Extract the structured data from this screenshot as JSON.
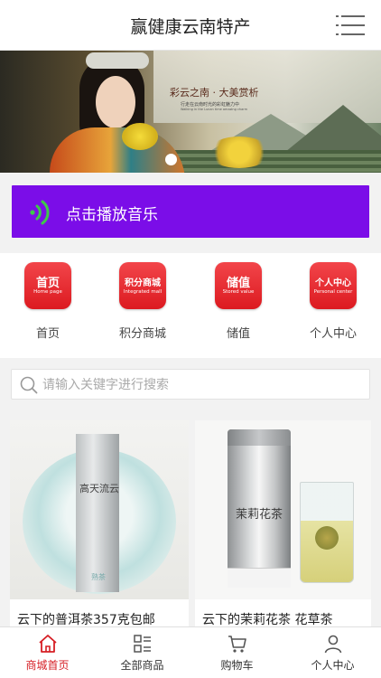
{
  "header": {
    "title": "赢健康云南特产",
    "menu_icon": "menu-list-icon"
  },
  "banner": {
    "caption_main": "彩云之南 · 大美赏析",
    "caption_sub": "行走在云南时光的彩虹魅力中",
    "caption_en": "Walking in the Lunan time amazing charm",
    "active_slide": 1,
    "slide_count": 1
  },
  "music": {
    "label": "点击播放音乐",
    "icon": "sound-wave-icon",
    "color": "#7b0de8"
  },
  "nav": {
    "items": [
      {
        "tile_cn": "首页",
        "tile_en": "Home page",
        "label": "首页"
      },
      {
        "tile_cn": "积分商城",
        "tile_en": "Integrated mall",
        "label": "积分商城"
      },
      {
        "tile_cn": "储值",
        "tile_en": "Stored value",
        "label": "储值"
      },
      {
        "tile_cn": "个人中心",
        "tile_en": "Personal center",
        "label": "个人中心"
      }
    ],
    "tile_color": "#e2262b"
  },
  "search": {
    "placeholder": "请输入关键字进行搜索",
    "value": "",
    "icon": "search-icon"
  },
  "products": [
    {
      "name": "云下的普洱茶357克包邮",
      "package_text": "高天流云",
      "wrapper_text": "熟茶"
    },
    {
      "name": "云下的茉莉花茶 花草茶",
      "package_text": "茉莉花茶"
    }
  ],
  "tabbar": {
    "items": [
      {
        "label": "商城首页",
        "icon": "home-icon",
        "active": true
      },
      {
        "label": "全部商品",
        "icon": "category-list-icon",
        "active": false
      },
      {
        "label": "购物车",
        "icon": "cart-icon",
        "active": false
      },
      {
        "label": "个人中心",
        "icon": "person-icon",
        "active": false
      }
    ],
    "active_color": "#d61e24"
  }
}
